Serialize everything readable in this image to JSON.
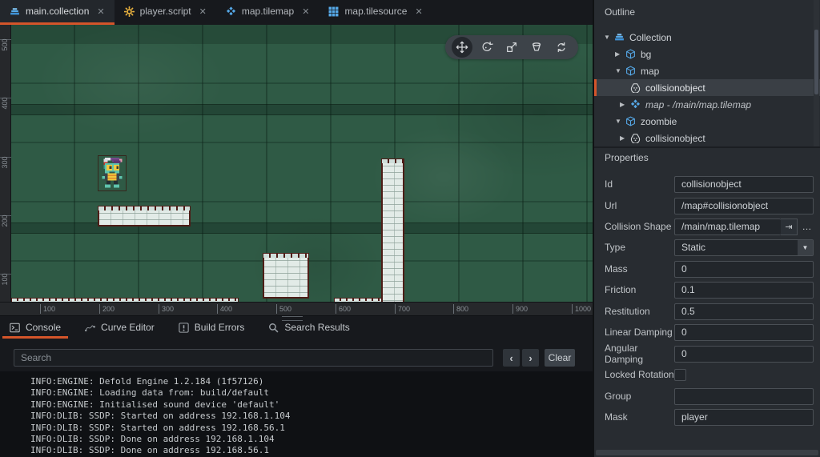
{
  "tabs": [
    {
      "label": "main.collection"
    },
    {
      "label": "player.script"
    },
    {
      "label": "map.tilemap"
    },
    {
      "label": "map.tilesource"
    }
  ],
  "ui": {
    "close": "✕",
    "caret_down": "▼",
    "ellipsis": "…",
    "jump_arrow": "⇥",
    "prev": "‹",
    "next": "›"
  },
  "viewport": {
    "ruler_h": [
      "100",
      "200",
      "300",
      "400",
      "500",
      "600",
      "700",
      "800",
      "900",
      "1000"
    ],
    "ruler_v": [
      "500",
      "400",
      "300",
      "200",
      "100"
    ]
  },
  "outline": {
    "title": "Outline",
    "items": [
      {
        "label": "Collection",
        "arrow": "▼"
      },
      {
        "label": "bg",
        "arrow": "▶"
      },
      {
        "label": "map",
        "arrow": "▼"
      },
      {
        "label": "collisionobject",
        "arrow": ""
      },
      {
        "label": "map - /main/map.tilemap",
        "arrow": "▶"
      },
      {
        "label": "zoombie",
        "arrow": "▼"
      },
      {
        "label": "collisionobject",
        "arrow": "▶"
      }
    ]
  },
  "properties": {
    "title": "Properties",
    "fields": [
      {
        "label": "Id",
        "value": "collisionobject"
      },
      {
        "label": "Url",
        "value": "/map#collisionobject"
      },
      {
        "label": "Collision Shape",
        "value": "/main/map.tilemap"
      },
      {
        "label": "Type",
        "value": "Static"
      },
      {
        "label": "Mass",
        "value": "0"
      },
      {
        "label": "Friction",
        "value": "0.1"
      },
      {
        "label": "Restitution",
        "value": "0.5"
      },
      {
        "label": "Linear Damping",
        "value": "0"
      },
      {
        "label": "Angular Damping",
        "value": "0"
      },
      {
        "label": "Locked Rotation",
        "value": ""
      },
      {
        "label": "Group",
        "value": ""
      },
      {
        "label": "Mask",
        "value": "player"
      }
    ]
  },
  "bottom": {
    "tabs": [
      {
        "label": "Console"
      },
      {
        "label": "Curve Editor"
      },
      {
        "label": "Build Errors"
      },
      {
        "label": "Search Results"
      }
    ],
    "search_placeholder": "Search",
    "clear_label": "Clear",
    "console_lines": [
      "INFO:ENGINE: Defold Engine 1.2.184 (1f57126)",
      "INFO:ENGINE: Loading data from: build/default",
      "INFO:ENGINE: Initialised sound device 'default'",
      "INFO:DLIB: SSDP: Started on address 192.168.1.104",
      "INFO:DLIB: SSDP: Started on address 192.168.56.1",
      "INFO:DLIB: SSDP: Done on address 192.168.1.104",
      "INFO:DLIB: SSDP: Done on address 192.168.56.1"
    ]
  },
  "colors": {
    "accent_orange": "#d4552a",
    "icon_blue": "#56a9e8",
    "icon_yellow": "#e8b13e",
    "platform_border": "#4e1d17",
    "scene_green": "#2e5743"
  }
}
